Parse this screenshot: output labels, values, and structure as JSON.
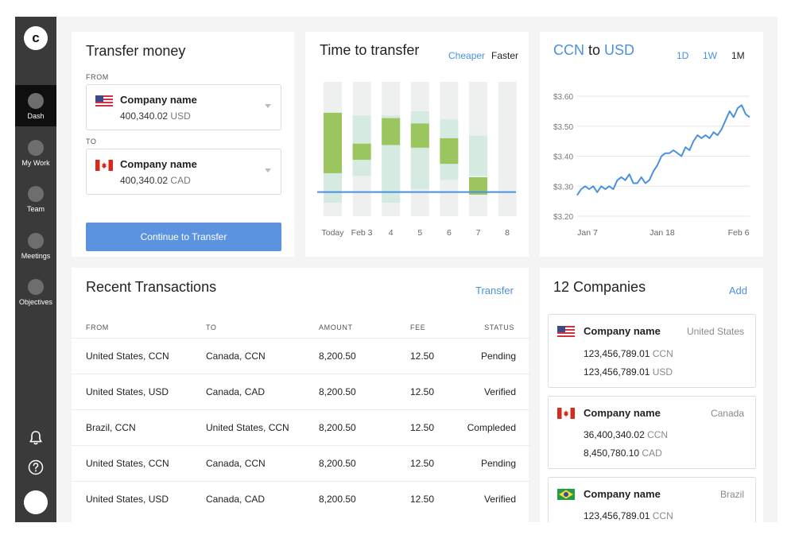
{
  "app": {
    "logo_letter": "c"
  },
  "sidebar": {
    "items": [
      {
        "label": "Dash",
        "active": true
      },
      {
        "label": "My Work",
        "active": false
      },
      {
        "label": "Team",
        "active": false
      },
      {
        "label": "Meetings",
        "active": false
      },
      {
        "label": "Objectives",
        "active": false
      }
    ],
    "bottom_icons": [
      "bell-icon",
      "help-icon",
      "avatar"
    ]
  },
  "transfer": {
    "title": "Transfer money",
    "from_label": "FROM",
    "to_label": "TO",
    "from": {
      "company": "Company name",
      "amount": "400,340.02",
      "currency": "USD",
      "flag": "us-flag-icon"
    },
    "to": {
      "company": "Company name",
      "amount": "400,340.02",
      "currency": "CAD",
      "flag": "canada-flag-icon"
    },
    "button": "Continue to Transfer"
  },
  "time_to_transfer": {
    "title": "Time to transfer",
    "toggle_cheaper": "Cheaper",
    "toggle_faster": "Faster",
    "active_toggle": "Faster",
    "colors": {
      "track": "#eef0ef",
      "light": "#d5eae1",
      "dark": "#9bc65f",
      "line": "#4a90e2"
    }
  },
  "chart_data": [
    {
      "type": "bar",
      "title": "Time to transfer",
      "categories": [
        "Today",
        "Feb 3",
        "4",
        "5",
        "6",
        "7",
        "8"
      ],
      "series": [
        {
          "values": [
            [
              0.55,
              0.1
            ],
            [
              0.75,
              0.3
            ],
            [
              0.75,
              0.1
            ],
            [
              0.78,
              0.2
            ],
            [
              0.72,
              0.27
            ],
            [
              0.6,
              0.3
            ],
            [
              null,
              null
            ]
          ]
        },
        {
          "values": [
            [
              0.77,
              0.32
            ],
            [
              0.54,
              0.42
            ],
            [
              0.73,
              0.53
            ],
            [
              0.69,
              0.51
            ],
            [
              0.58,
              0.39
            ],
            [
              0.29,
              0.16
            ],
            [
              null,
              null
            ]
          ]
        }
      ],
      "reference_line": 0.18,
      "ylim": [
        0,
        1
      ]
    },
    {
      "type": "line",
      "title": "CCN to USD",
      "x_ticks": [
        "Jan 7",
        "Jan 18",
        "Feb 6"
      ],
      "y_ticks": [
        "$3.60",
        "$3.50",
        "$3.40",
        "$3.30",
        "$3.20"
      ],
      "ylim": [
        3.2,
        3.6
      ],
      "grid": true,
      "series": [
        {
          "color": "#4a90e2",
          "values": [
            3.27,
            3.29,
            3.3,
            3.29,
            3.3,
            3.28,
            3.3,
            3.29,
            3.3,
            3.29,
            3.32,
            3.33,
            3.32,
            3.34,
            3.31,
            3.31,
            3.33,
            3.31,
            3.32,
            3.35,
            3.37,
            3.4,
            3.41,
            3.41,
            3.42,
            3.41,
            3.4,
            3.43,
            3.42,
            3.45,
            3.47,
            3.46,
            3.47,
            3.46,
            3.48,
            3.47,
            3.49,
            3.52,
            3.55,
            3.53,
            3.56,
            3.57,
            3.54,
            3.53
          ]
        }
      ]
    }
  ],
  "rate": {
    "base": "CCN",
    "connector": "to",
    "quote": "USD",
    "ranges": [
      "1D",
      "1W",
      "1M"
    ],
    "active_range": "1M"
  },
  "transactions": {
    "title": "Recent Transactions",
    "action": "Transfer",
    "columns": [
      "FROM",
      "TO",
      "AMOUNT",
      "FEE",
      "STATUS"
    ],
    "rows": [
      {
        "from": "United States, CCN",
        "to": "Canada, CCN",
        "amount": "8,200.50",
        "fee": "12.50",
        "status": "Pending"
      },
      {
        "from": "United States, USD",
        "to": "Canada, CAD",
        "amount": "8,200.50",
        "fee": "12.50",
        "status": "Verified"
      },
      {
        "from": "Brazil, CCN",
        "to": "United States, CCN",
        "amount": "8,200.50",
        "fee": "12.50",
        "status": "Compleded"
      },
      {
        "from": "United States, CCN",
        "to": "Canada, CCN",
        "amount": "8,200.50",
        "fee": "12.50",
        "status": "Pending"
      },
      {
        "from": "United States, USD",
        "to": "Canada, CAD",
        "amount": "8,200.50",
        "fee": "12.50",
        "status": "Verified"
      }
    ]
  },
  "companies": {
    "title": "12 Companies",
    "action": "Add",
    "items": [
      {
        "name": "Company name",
        "country": "United States",
        "flag": "us-flag-icon",
        "lines": [
          {
            "amount": "123,456,789.01",
            "currency": "CCN"
          },
          {
            "amount": "123,456,789.01",
            "currency": "USD"
          }
        ]
      },
      {
        "name": "Company name",
        "country": "Canada",
        "flag": "canada-flag-icon",
        "lines": [
          {
            "amount": "36,400,340.02",
            "currency": "CCN"
          },
          {
            "amount": "8,450,780.10",
            "currency": "CAD"
          }
        ]
      },
      {
        "name": "Company name",
        "country": "Brazil",
        "flag": "brazil-flag-icon",
        "lines": [
          {
            "amount": "123,456,789.01",
            "currency": "CCN"
          }
        ]
      }
    ]
  }
}
